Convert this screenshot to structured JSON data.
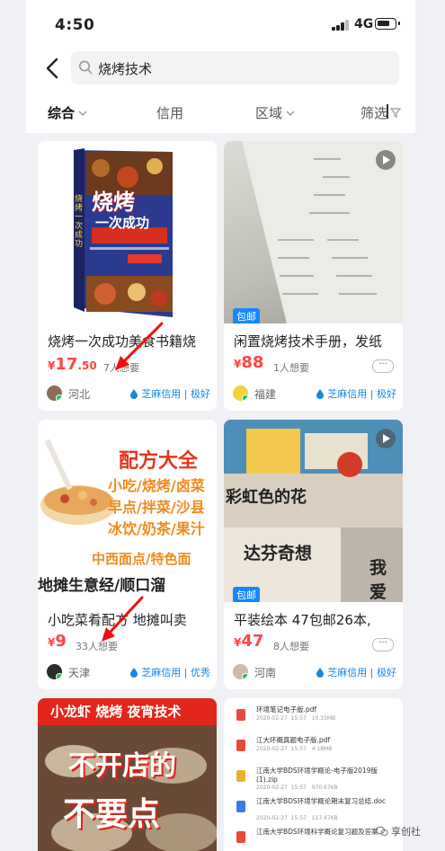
{
  "status": {
    "time": "4:50",
    "network": "4G"
  },
  "search": {
    "query": "烧烤技术"
  },
  "filters": [
    {
      "label": "综合",
      "active": true
    },
    {
      "label": "信用",
      "active": false
    },
    {
      "label": "区域",
      "active": false
    },
    {
      "label": "筛选",
      "active": false
    }
  ],
  "products": [
    {
      "title": "烧烤一次成功美食书籍烧",
      "price_int": "17",
      "price_dec": ".50",
      "wants": "7人想要",
      "location": "河北",
      "credit": "芝麻信用 | 极好",
      "image_text": {
        "line1": "烧烤",
        "line2": "一次成功",
        "side": "烧烤一次成功"
      }
    },
    {
      "title": "闲置烧烤技术手册，发纸",
      "price_int": "88",
      "price_dec": "",
      "wants": "1人想要",
      "location": "福建",
      "credit": "芝麻信用 | 极好",
      "badge": "包邮"
    },
    {
      "title": "小吃菜肴配方 地摊叫卖",
      "price_int": "9",
      "price_dec": "",
      "wants": "33人想要",
      "location": "天津",
      "credit": "芝麻信用 | 优秀",
      "image_text": {
        "line1": "配方大全",
        "line2": "小吃/烧烤/卤菜",
        "line3": "早点/拌菜/沙县",
        "line4": "冰饮/奶茶/果汁",
        "line5": "中西面点/特色面",
        "line6": "地摊生意经/顺口溜"
      }
    },
    {
      "title": "平装绘本 47包邮26本,",
      "price_int": "47",
      "price_dec": "",
      "wants": "8人想要",
      "location": "河南",
      "credit": "芝麻信用 | 极好",
      "badge": "包邮",
      "image_text": {
        "a": "彩虹色的花",
        "b": "达芬奇想",
        "c": "我爱"
      }
    },
    {
      "image_text": {
        "banner": "小龙虾 烧烤 夜宵技术",
        "line1": "不开店的",
        "line2": "不要点"
      }
    },
    {
      "files": [
        {
          "name": "环境笔记电子版.pdf",
          "meta": "2020-02-27  15:57   10.33MB"
        },
        {
          "name": "江大环概真题电子版.pdf",
          "meta": "2020-02-27  15:57   4.18MB"
        },
        {
          "name": "江南大学BDS环境学概论-电子版2019版(1).zip",
          "meta": "2020-02-27  15:57   970.67KB"
        },
        {
          "name": "江南大学BDS环境学概论期末复习总结.doc",
          "meta": "2020-02-27  15:57   117.47KB"
        },
        {
          "name": "江南大学BDS环境科学概论复习题及答案",
          "meta": ""
        }
      ]
    }
  ],
  "watermark": "享创社",
  "colors": {
    "price": "#ff4444",
    "credit": "#1686e4",
    "badge": "#1687ff",
    "bg": "#f0f1f4"
  }
}
